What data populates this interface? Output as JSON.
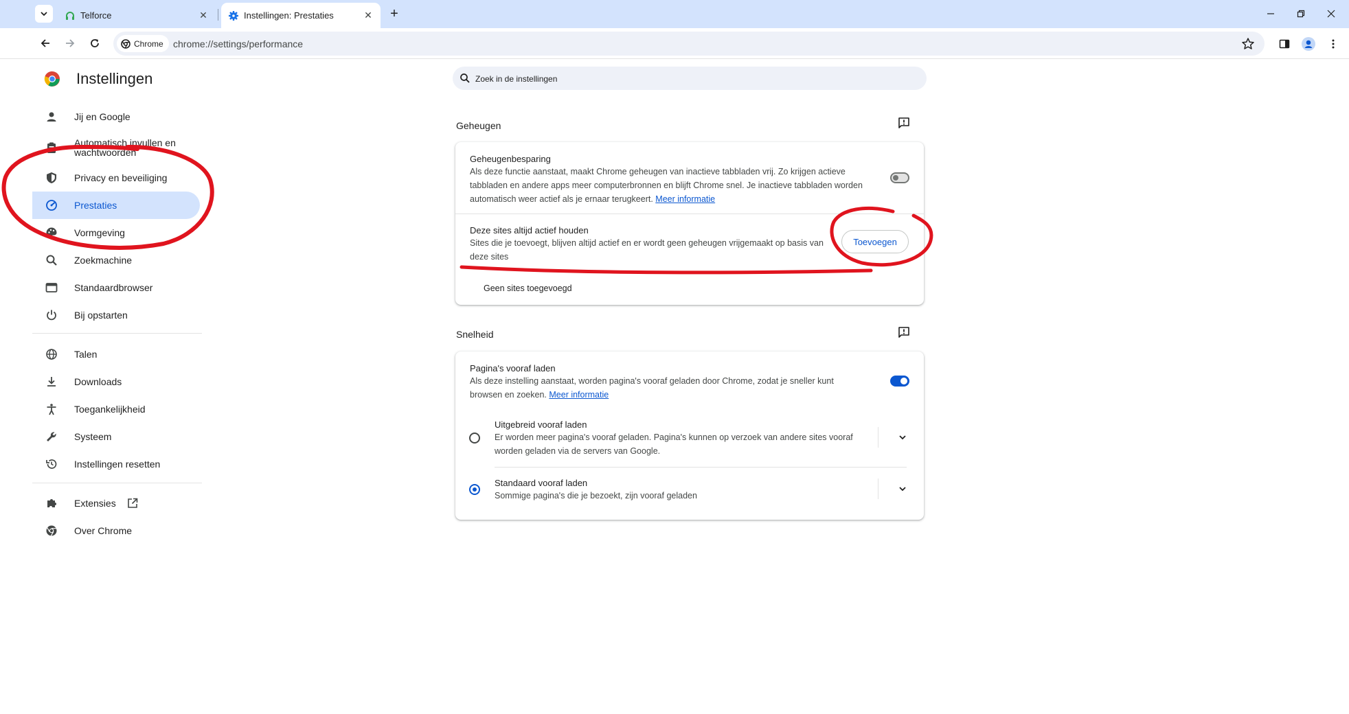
{
  "browser": {
    "tabs": [
      {
        "title": "Telforce",
        "active": false,
        "icon": "headset-icon"
      },
      {
        "title": "Instellingen: Prestaties",
        "active": true,
        "icon": "gear-icon"
      }
    ],
    "omnibox": {
      "chip_label": "Chrome",
      "url": "chrome://settings/performance"
    }
  },
  "sidebar": {
    "title": "Instellingen",
    "items": [
      {
        "label": "Jij en Google",
        "icon": "person-icon"
      },
      {
        "label": "Automatisch invullen en wachtwoorden",
        "icon": "clipboard-icon"
      },
      {
        "label": "Privacy en beveiliging",
        "icon": "shield-icon"
      },
      {
        "label": "Prestaties",
        "icon": "speedometer-icon",
        "active": true
      },
      {
        "label": "Vormgeving",
        "icon": "palette-icon"
      },
      {
        "label": "Zoekmachine",
        "icon": "search-icon"
      },
      {
        "label": "Standaardbrowser",
        "icon": "browser-window-icon"
      },
      {
        "label": "Bij opstarten",
        "icon": "power-icon"
      },
      {
        "label": "Talen",
        "icon": "globe-icon"
      },
      {
        "label": "Downloads",
        "icon": "download-icon"
      },
      {
        "label": "Toegankelijkheid",
        "icon": "accessibility-icon"
      },
      {
        "label": "Systeem",
        "icon": "wrench-icon"
      },
      {
        "label": "Instellingen resetten",
        "icon": "history-icon"
      },
      {
        "label": "Extensies",
        "icon": "puzzle-icon"
      },
      {
        "label": "Over Chrome",
        "icon": "chrome-icon"
      }
    ]
  },
  "search": {
    "placeholder": "Zoek in de instellingen"
  },
  "memory": {
    "section_title": "Geheugen",
    "saver_title": "Geheugenbesparing",
    "saver_desc": "Als deze functie aanstaat, maakt Chrome geheugen van inactieve tabbladen vrij. Zo krijgen actieve tabbladen en andere apps meer computerbronnen en blijft Chrome snel. Je inactieve tabbladen worden automatisch weer actief als je ernaar terugkeert.",
    "saver_link": "Meer informatie",
    "saver_enabled": false,
    "always_active_title": "Deze sites altijd actief houden",
    "always_active_desc": "Sites die je toevoegt, blijven altijd actief en er wordt geen geheugen vrijgemaakt op basis van deze sites",
    "add_button": "Toevoegen",
    "no_sites": "Geen sites toegevoegd"
  },
  "speed": {
    "section_title": "Snelheid",
    "preload_title": "Pagina's vooraf laden",
    "preload_desc": "Als deze instelling aanstaat, worden pagina's vooraf geladen door Chrome, zodat je sneller kunt browsen en zoeken.",
    "preload_link": "Meer informatie",
    "preload_enabled": true,
    "options": [
      {
        "title": "Uitgebreid vooraf laden",
        "desc": "Er worden meer pagina's vooraf geladen. Pagina's kunnen op verzoek van andere sites vooraf worden geladen via de servers van Google.",
        "selected": false
      },
      {
        "title": "Standaard vooraf laden",
        "desc": "Sommige pagina's die je bezoekt, zijn vooraf geladen",
        "selected": true
      }
    ]
  },
  "colors": {
    "accent": "#0b57d0",
    "annotation": "#e0141e",
    "tabstrip": "#d3e3fd"
  }
}
